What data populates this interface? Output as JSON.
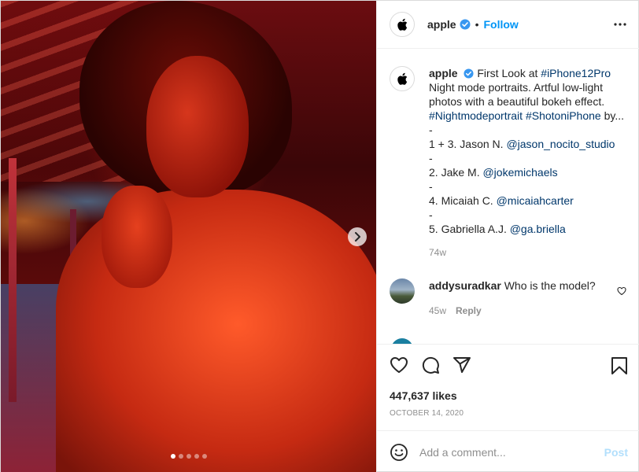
{
  "header": {
    "username": "apple",
    "separator": "•",
    "follow_label": "Follow"
  },
  "media": {
    "slide_count": 5,
    "active_slide": 1
  },
  "caption": {
    "username": "apple",
    "line1": "First Look at ",
    "line1_tag": "#iPhone12Pro",
    "line2": "Night mode portraits. Artful low-light",
    "line3": "photos with a beautiful bokeh effect.",
    "line4_tag1": "#Nightmodeportrait",
    "line4_tag2": "#ShotoniPhone",
    "line4_tail": " by...",
    "dash": "-",
    "credit1_text": "1 + 3. Jason N. ",
    "credit1_handle": "@jason_nocito_studio",
    "credit2_text": "2. Jake M. ",
    "credit2_handle": "@jokemichaels",
    "credit3_text": "4. Micaiah C. ",
    "credit3_handle": "@micaiahcarter",
    "credit4_text": "5. Gabriella A.J. ",
    "credit4_handle": "@ga.briella",
    "time": "74w"
  },
  "comment": {
    "username": "addysuradkar",
    "text": " Who is the model?",
    "time": "45w",
    "reply_label": "Reply"
  },
  "engagement": {
    "likes": "447,637 likes",
    "date": "OCTOBER 14, 2020"
  },
  "add_comment": {
    "placeholder": "Add a comment...",
    "post_label": "Post"
  },
  "colors": {
    "accent": "#0095f6",
    "link": "#00376b",
    "muted": "#8e8e8e",
    "post_disabled": "#b2dffc",
    "verified": "#3897f0"
  },
  "icons": [
    "apple-logo-icon",
    "verified-badge-icon",
    "more-options-icon",
    "next-arrow-icon",
    "heart-icon",
    "comment-icon",
    "share-icon",
    "bookmark-icon",
    "emoji-icon"
  ]
}
